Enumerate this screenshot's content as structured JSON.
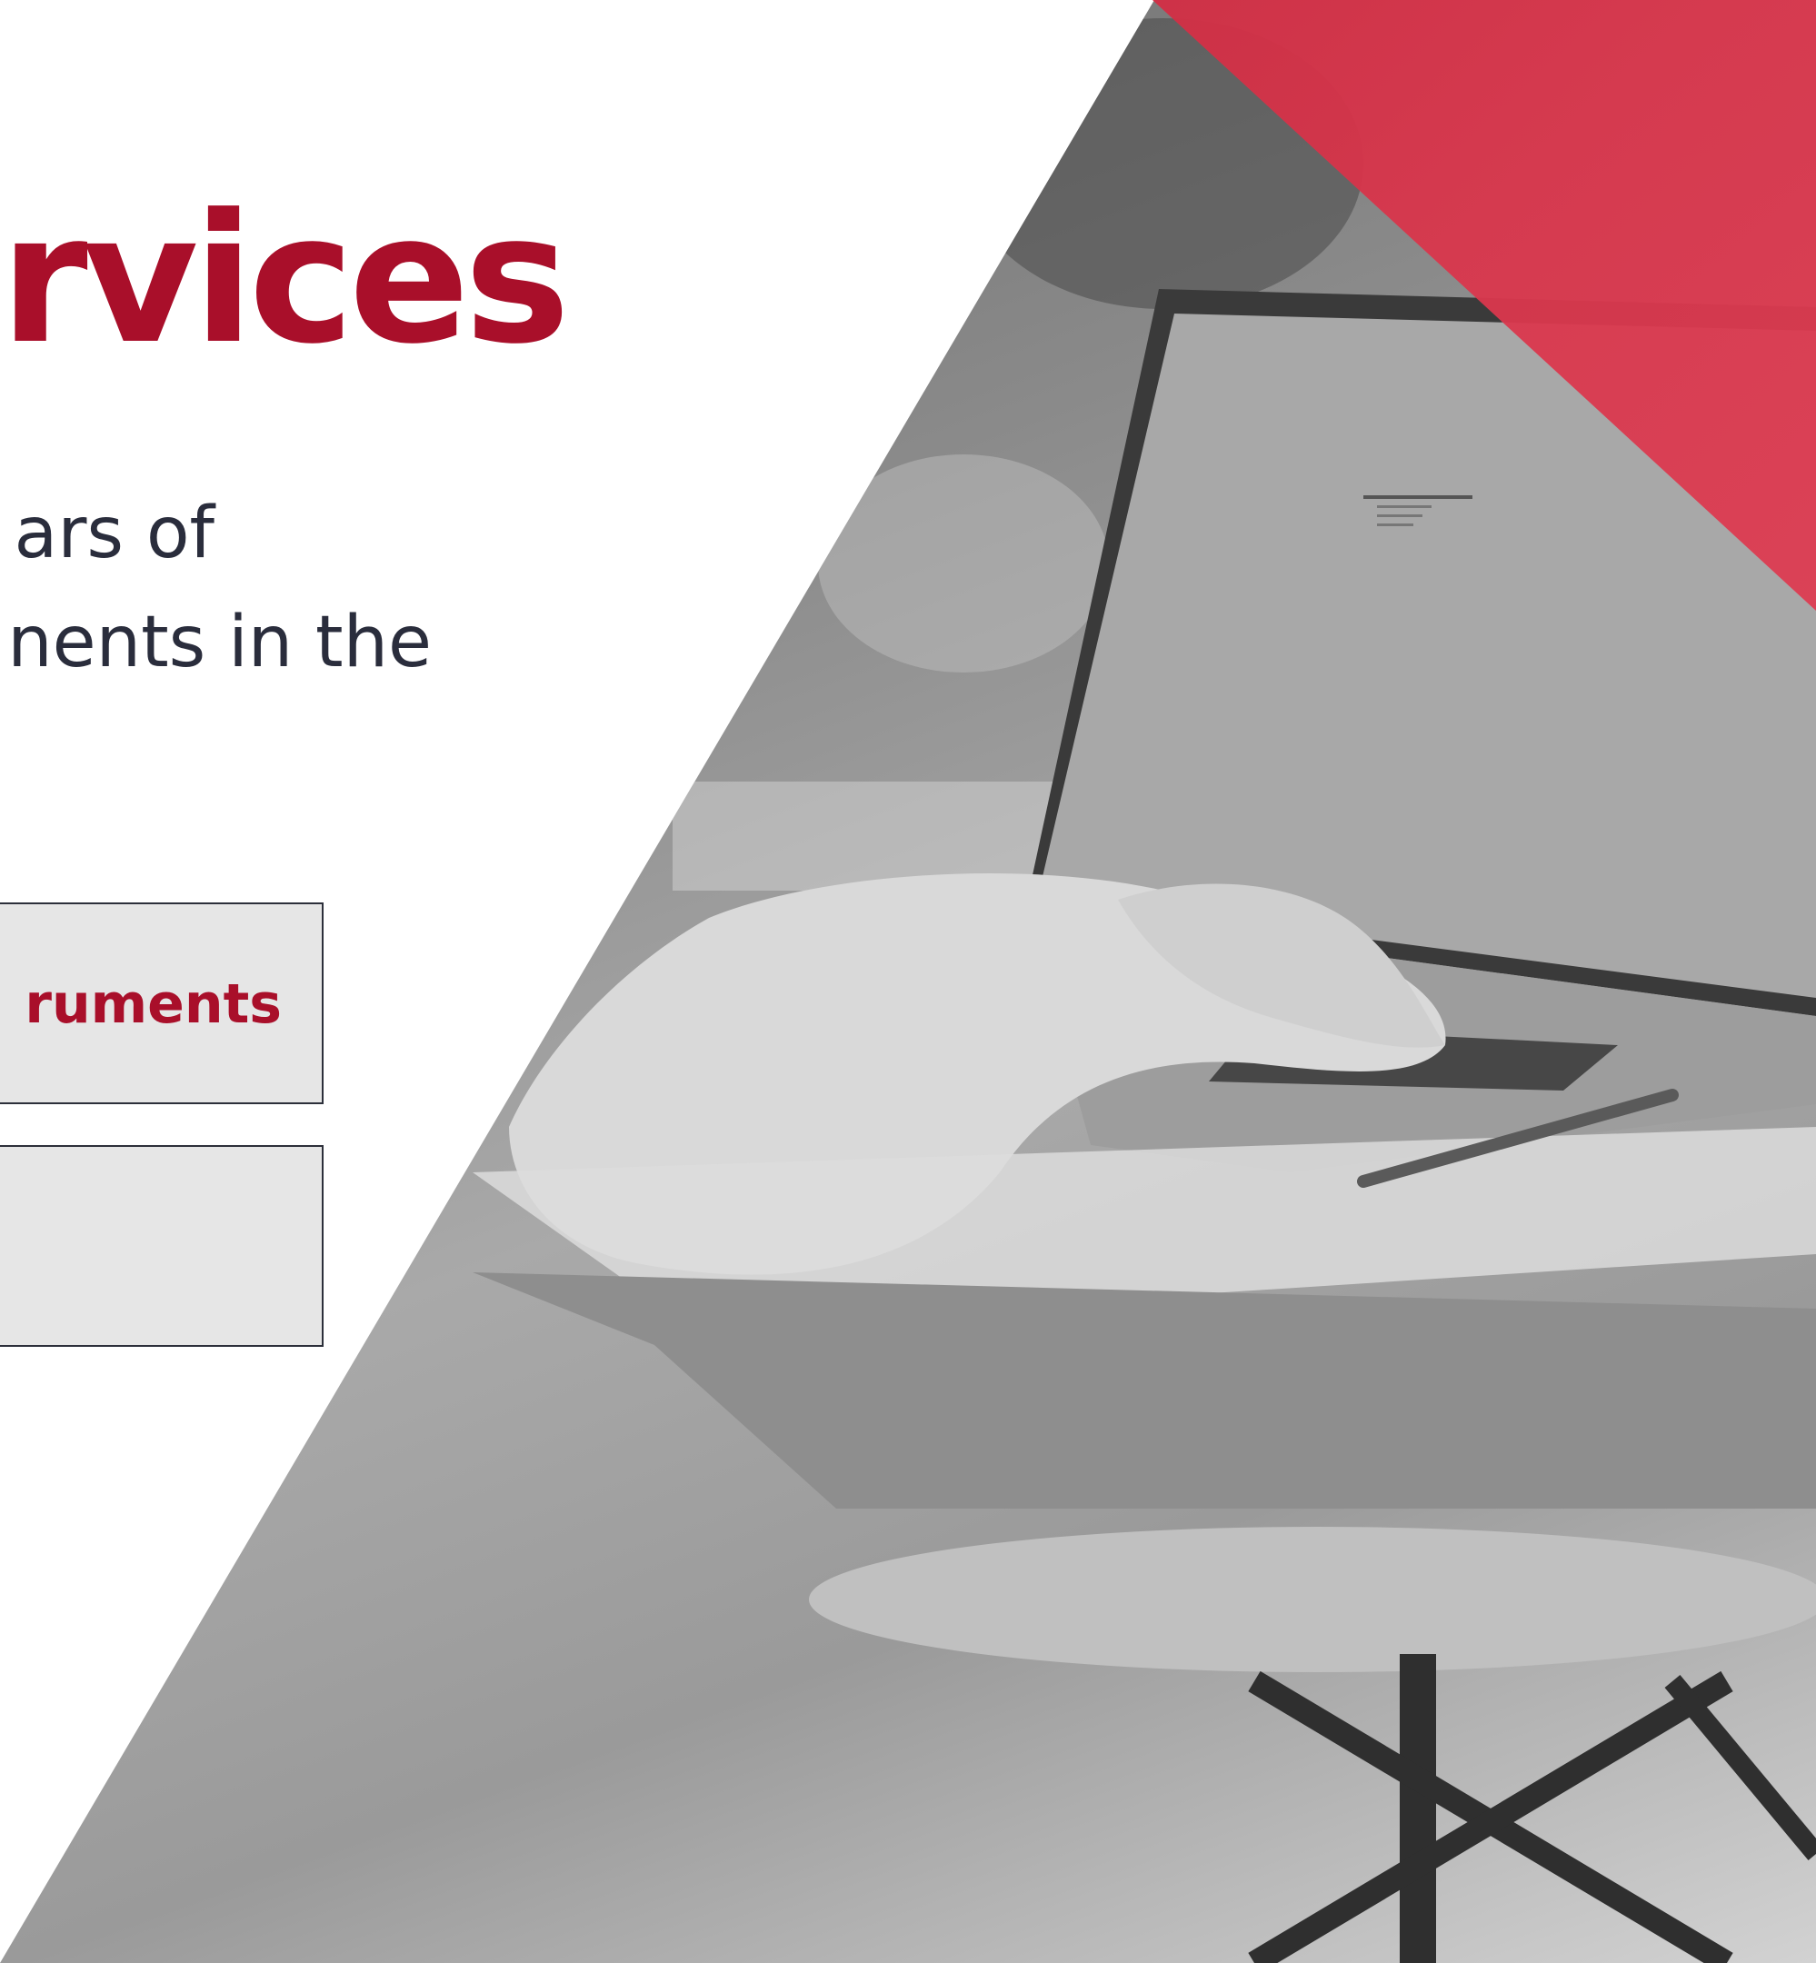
{
  "hero": {
    "heading": "rvices",
    "description_lines": [
      "ars of",
      "nents in the"
    ]
  },
  "cards": [
    {
      "label": "ruments"
    },
    {
      "label": ""
    }
  ],
  "colors": {
    "accent_red": "#a90f2a",
    "triangle_red": "#d9364c",
    "text_dark": "#2a2d3c",
    "card_bg": "#e6e6e6",
    "card_border": "#2c2f3a"
  },
  "image": {
    "subject": "grayscale-photo-person-typing-on-laptop"
  }
}
